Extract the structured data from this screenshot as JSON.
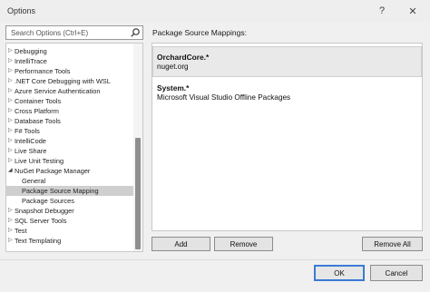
{
  "window": {
    "title": "Options",
    "help_glyph": "?",
    "close_glyph": "✕"
  },
  "search": {
    "placeholder": "Search Options (Ctrl+E)",
    "icon": "search-icon"
  },
  "tree": {
    "items": [
      {
        "label": "Debugging",
        "expandable": true,
        "child": false,
        "selected": false
      },
      {
        "label": "IntelliTrace",
        "expandable": true,
        "child": false,
        "selected": false
      },
      {
        "label": "Performance Tools",
        "expandable": true,
        "child": false,
        "selected": false
      },
      {
        "label": ".NET Core Debugging with WSL",
        "expandable": true,
        "child": false,
        "selected": false
      },
      {
        "label": "Azure Service Authentication",
        "expandable": true,
        "child": false,
        "selected": false
      },
      {
        "label": "Container Tools",
        "expandable": true,
        "child": false,
        "selected": false
      },
      {
        "label": "Cross Platform",
        "expandable": true,
        "child": false,
        "selected": false
      },
      {
        "label": "Database Tools",
        "expandable": true,
        "child": false,
        "selected": false
      },
      {
        "label": "F# Tools",
        "expandable": true,
        "child": false,
        "selected": false
      },
      {
        "label": "IntelliCode",
        "expandable": true,
        "child": false,
        "selected": false
      },
      {
        "label": "Live Share",
        "expandable": true,
        "child": false,
        "selected": false
      },
      {
        "label": "Live Unit Testing",
        "expandable": true,
        "child": false,
        "selected": false
      },
      {
        "label": "NuGet Package Manager",
        "expandable": true,
        "expanded": true,
        "child": false,
        "selected": false
      },
      {
        "label": "General",
        "expandable": false,
        "child": true,
        "selected": false
      },
      {
        "label": "Package Source Mapping",
        "expandable": false,
        "child": true,
        "selected": true
      },
      {
        "label": "Package Sources",
        "expandable": false,
        "child": true,
        "selected": false
      },
      {
        "label": "Snapshot Debugger",
        "expandable": true,
        "child": false,
        "selected": false
      },
      {
        "label": "SQL Server Tools",
        "expandable": true,
        "child": false,
        "selected": false
      },
      {
        "label": "Test",
        "expandable": true,
        "child": false,
        "selected": false
      },
      {
        "label": "Text Templating",
        "expandable": true,
        "child": false,
        "selected": false
      }
    ]
  },
  "panel": {
    "heading": "Package Source Mappings:",
    "mappings": [
      {
        "pattern": "OrchardCore.*",
        "source": "nuget.org",
        "selected": true
      },
      {
        "pattern": "System.*",
        "source": "Microsoft Visual Studio Offline Packages",
        "selected": false
      }
    ],
    "add_label": "Add",
    "remove_label": "Remove",
    "remove_all_label": "Remove All"
  },
  "footer": {
    "ok_label": "OK",
    "cancel_label": "Cancel"
  },
  "colors": {
    "accent": "#3a7bd5",
    "selection": "#cfcfcf"
  }
}
